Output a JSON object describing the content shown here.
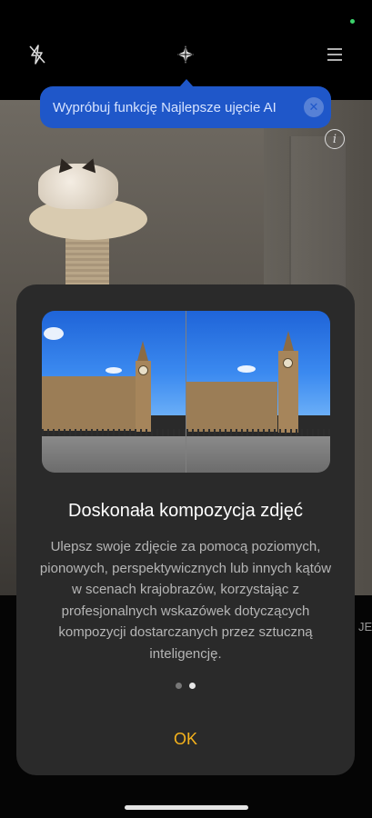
{
  "tooltip": {
    "text": "Wypróbuj funkcję Najlepsze ujęcie AI"
  },
  "top_icons": [
    "flash-off-icon",
    "ai-composition-icon",
    "menu-icon"
  ],
  "dialog": {
    "title": "Doskonała kompozycja zdjęć",
    "body": "Ulepsz swoje zdjęcie za pomocą poziomych, pionowych, perspektywicznych lub innych kątów w scenach krajobrazów, korzystając z profesjonalnych wskazówek dotyczących kompozycji dostarczanych przez sztuczną inteligencję.",
    "ok_label": "OK",
    "pages": 2,
    "current_page": 2
  },
  "mode_label_partial": "JE",
  "colors": {
    "accent": "#f5b21c",
    "tooltip_bg": "#1f57c9",
    "status_dot": "#3cd36b"
  }
}
